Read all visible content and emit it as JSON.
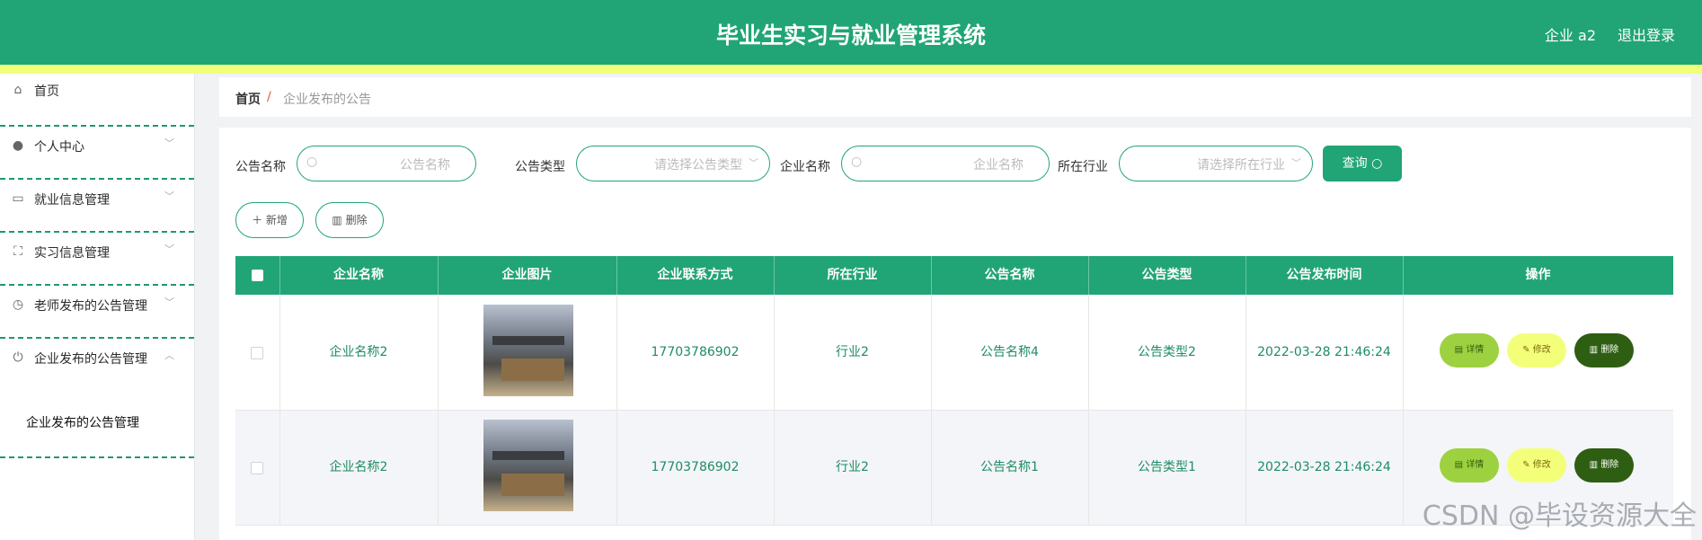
{
  "header": {
    "title": "毕业生实习与就业管理系统",
    "user": "企业 a2",
    "logout": "退出登录"
  },
  "sidebar": {
    "items": [
      {
        "label": "首页",
        "icon": "home-icon"
      },
      {
        "label": "个人中心",
        "icon": "user-icon"
      },
      {
        "label": "就业信息管理",
        "icon": "chat-icon"
      },
      {
        "label": "实习信息管理",
        "icon": "scan-icon"
      },
      {
        "label": "老师发布的公告管理",
        "icon": "clock-icon"
      },
      {
        "label": "企业发布的公告管理",
        "icon": "power-icon"
      }
    ],
    "submenu_label": "企业发布的公告管理"
  },
  "breadcrumb": {
    "home": "首页",
    "sep": "/",
    "current": "企业发布的公告"
  },
  "filters": {
    "notice_name_label": "公告名称",
    "notice_name_placeholder": "公告名称",
    "notice_type_label": "公告类型",
    "notice_type_placeholder": "请选择公告类型",
    "company_name_label": "企业名称",
    "company_name_placeholder": "企业名称",
    "industry_label": "所在行业",
    "industry_placeholder": "请选择所在行业",
    "query_button": "查询"
  },
  "actions": {
    "add": "新增",
    "delete": "删除"
  },
  "table": {
    "headers": [
      "企业名称",
      "企业图片",
      "企业联系方式",
      "所在行业",
      "公告名称",
      "公告类型",
      "公告发布时间",
      "操作"
    ],
    "rows": [
      {
        "company": "企业名称2",
        "phone": "17703786902",
        "industry": "行业2",
        "notice": "公告名称4",
        "type": "公告类型2",
        "time": "2022-03-28 21:46:24"
      },
      {
        "company": "企业名称2",
        "phone": "17703786902",
        "industry": "行业2",
        "notice": "公告名称1",
        "type": "公告类型1",
        "time": "2022-03-28 21:46:24"
      }
    ],
    "row_actions": {
      "detail": "详情",
      "edit": "修改",
      "delete": "删除"
    }
  },
  "watermark": "CSDN @毕设资源大全",
  "colors": {
    "primary": "#21a576",
    "accent_yellow": "#f1ff79",
    "detail_green": "#9ed13f",
    "delete_dark": "#2e5e12"
  }
}
